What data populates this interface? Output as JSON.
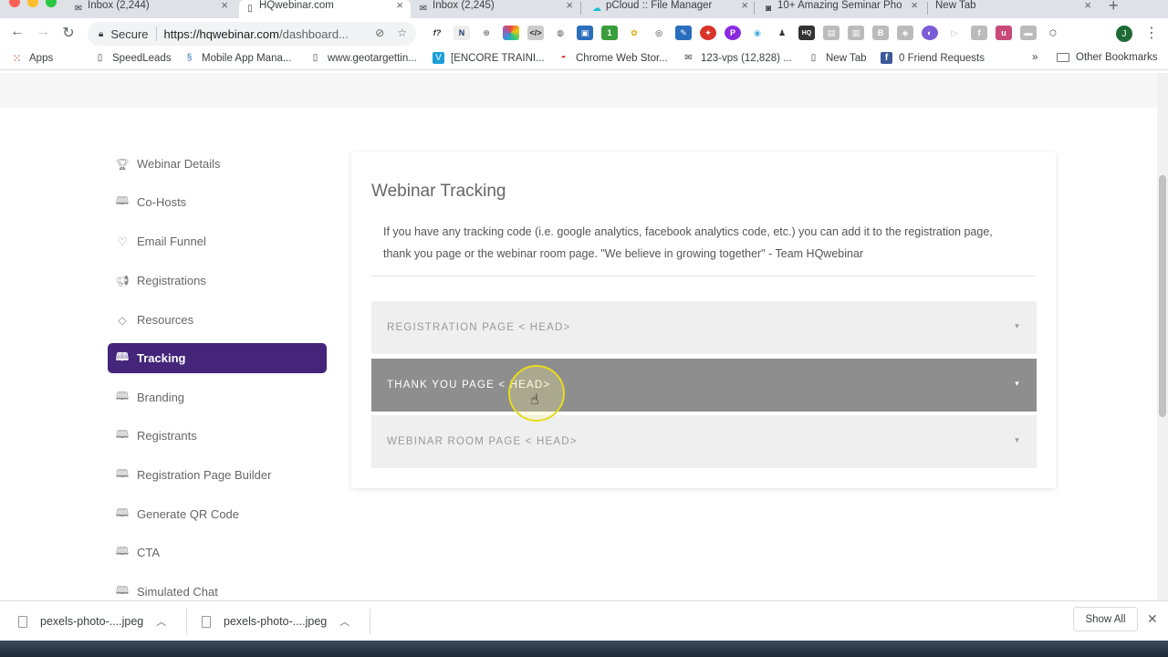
{
  "browser": {
    "tabs": [
      {
        "title": "Inbox (2,244)",
        "icon": "mail-icon",
        "active": false
      },
      {
        "title": "HQwebinar.com",
        "icon": "page-icon",
        "active": true
      },
      {
        "title": "Inbox (2,245)",
        "icon": "mail-icon",
        "active": false
      },
      {
        "title": "pCloud :: File Manager",
        "icon": "cloud-icon",
        "active": false
      },
      {
        "title": "10+ Amazing Seminar Pho",
        "icon": "camera-icon",
        "active": false
      },
      {
        "title": "New Tab",
        "icon": "",
        "active": false
      }
    ],
    "address": {
      "secure_label": "Secure",
      "url_host": "https://hqwebinar.com",
      "url_path": "/dashboard..."
    },
    "bookmarks": [
      {
        "label": "Apps",
        "icon": "apps-grid-icon"
      },
      {
        "label": "SpeedLeads",
        "icon": "page-icon"
      },
      {
        "label": "Mobile App Mana...",
        "icon": "swirl-icon"
      },
      {
        "label": "www.geotargettin...",
        "icon": "page-icon"
      },
      {
        "label": "[ENCORE TRAINI...",
        "icon": "v-icon"
      },
      {
        "label": "Chrome Web Stor...",
        "icon": "store-icon"
      },
      {
        "label": "123-vps (12,828) ...",
        "icon": "mail-icon"
      },
      {
        "label": "New Tab",
        "icon": "page-icon"
      },
      {
        "label": "0 Friend Requests",
        "icon": "facebook-icon"
      },
      {
        "label": "Other Bookmarks",
        "icon": "folder-icon"
      }
    ],
    "profile_initial": "J"
  },
  "sidebar": {
    "items": [
      {
        "label": "Webinar Details",
        "icon": "trophy-icon",
        "active": false
      },
      {
        "label": "Co-Hosts",
        "icon": "book-icon",
        "active": false
      },
      {
        "label": "Email Funnel",
        "icon": "heart-icon",
        "active": false
      },
      {
        "label": "Registrations",
        "icon": "megaphone-icon",
        "active": false
      },
      {
        "label": "Resources",
        "icon": "diamond-icon",
        "active": false
      },
      {
        "label": "Tracking",
        "icon": "book-icon",
        "active": true
      },
      {
        "label": "Branding",
        "icon": "book-icon",
        "active": false
      },
      {
        "label": "Registrants",
        "icon": "book-icon",
        "active": false
      },
      {
        "label": "Registration Page Builder",
        "icon": "book-icon",
        "active": false
      },
      {
        "label": "Generate QR Code",
        "icon": "book-icon",
        "active": false
      },
      {
        "label": "CTA",
        "icon": "book-icon",
        "active": false
      },
      {
        "label": "Simulated Chat",
        "icon": "book-icon",
        "active": false
      }
    ]
  },
  "main": {
    "title": "Webinar Tracking",
    "description": "If you have any tracking code (i.e. google analytics, facebook analytics code, etc.) you can add it to the registration page, thank you page or the webinar room page. \"We believe in growing together\" - Team HQwebinar",
    "accordion": [
      {
        "label": "REGISTRATION PAGE < HEAD>",
        "hovered": false
      },
      {
        "label": "THANK YOU PAGE < HEAD>",
        "hovered": true
      },
      {
        "label": "WEBINAR ROOM PAGE < HEAD>",
        "hovered": false
      }
    ]
  },
  "downloads": {
    "items": [
      {
        "filename": "pexels-photo-....jpeg"
      },
      {
        "filename": "pexels-photo-....jpeg"
      }
    ],
    "show_all_label": "Show All"
  },
  "colors": {
    "accent": "#44257a",
    "accordion_bg": "#efefef",
    "accordion_hover_bg": "#8e8e8e"
  }
}
